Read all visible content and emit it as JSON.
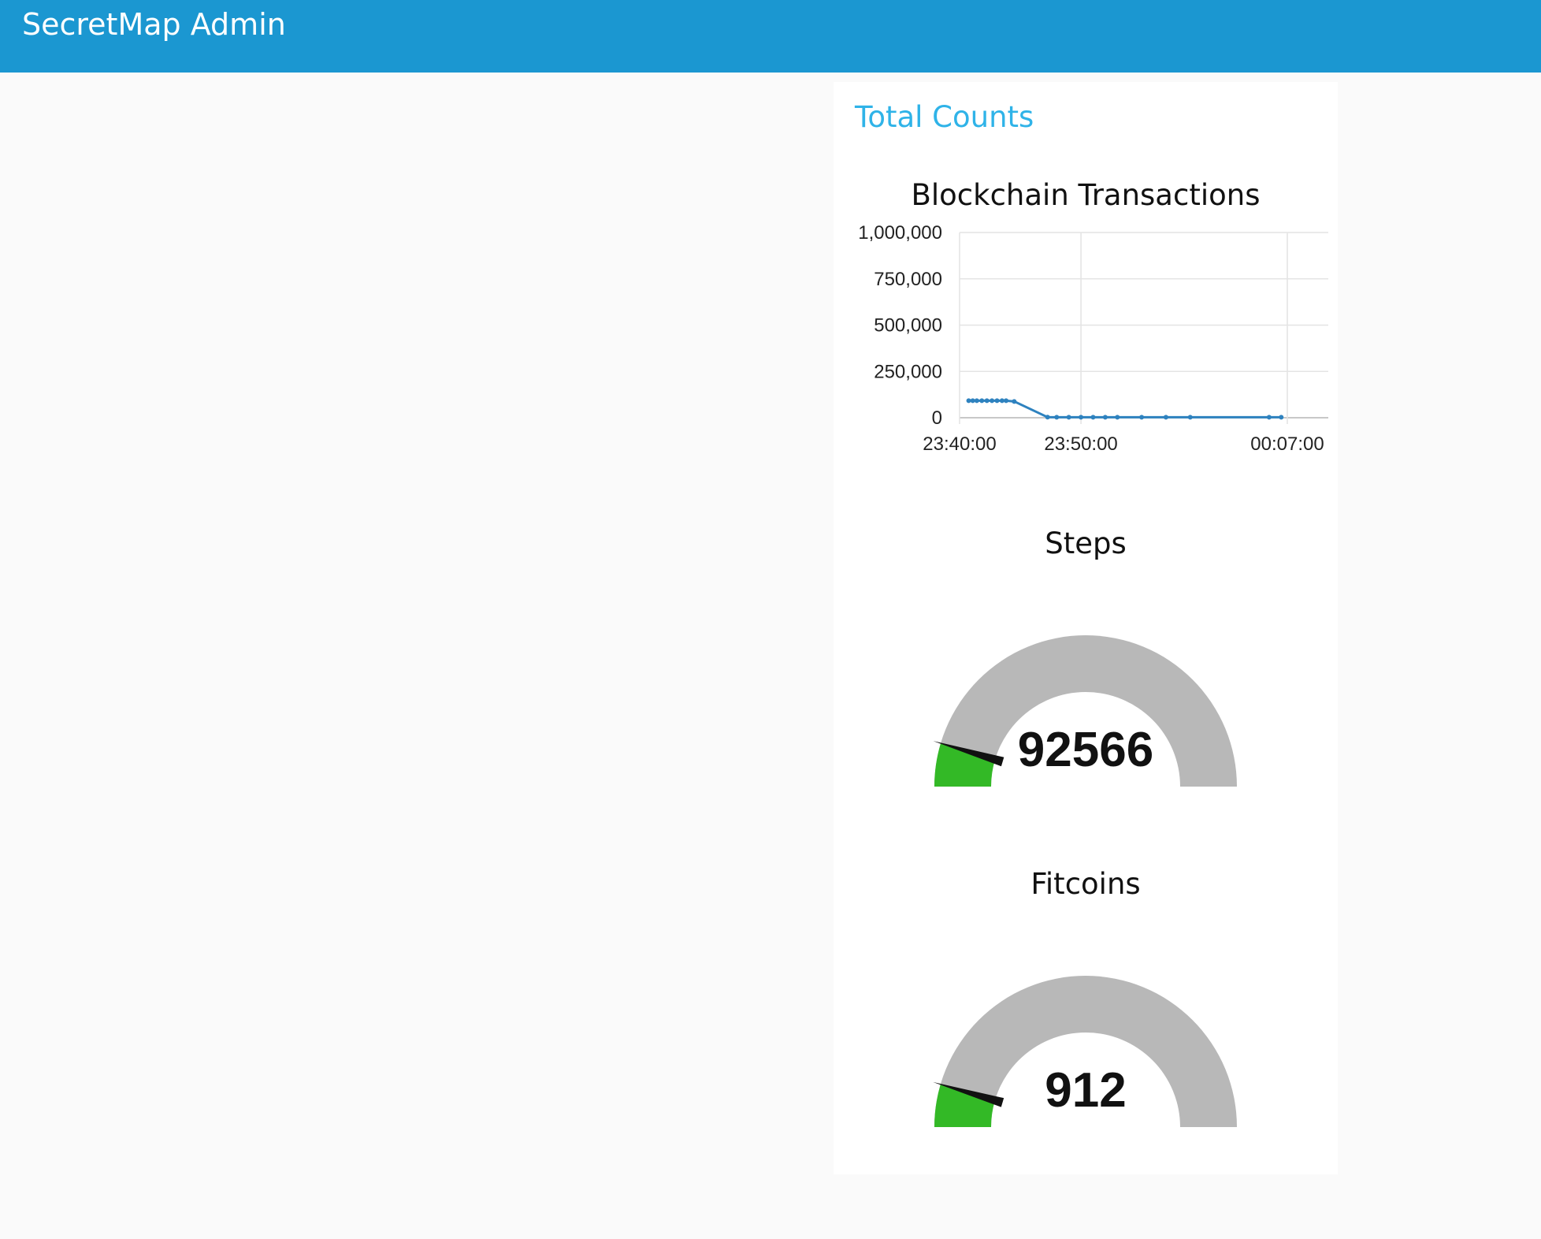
{
  "app": {
    "title": "SecretMap Admin"
  },
  "panel": {
    "title": "Total Counts"
  },
  "colors": {
    "header": "#1b97d1",
    "panel_title": "#2fb3e8",
    "line": "#2e82bf",
    "gauge_fill": "#33b926",
    "gauge_track": "#b8b8b8"
  },
  "chart_data": {
    "type": "line",
    "title": "Blockchain Transactions",
    "xlabel": "",
    "ylabel": "",
    "ylim": [
      0,
      1000000
    ],
    "yticks": [
      0,
      250000,
      500000,
      750000,
      1000000
    ],
    "ytick_labels": [
      "0",
      "250,000",
      "500,000",
      "750,000",
      "1,000,000"
    ],
    "xticks": [
      "23:40:00",
      "23:50:00",
      "00:07:00"
    ],
    "xticks_min": [
      0,
      10,
      27
    ],
    "grid": true,
    "series": [
      {
        "points": [
          {
            "x": "23:40:45",
            "y": 92000
          },
          {
            "x": "23:41:05",
            "y": 92000
          },
          {
            "x": "23:41:25",
            "y": 92000
          },
          {
            "x": "23:41:50",
            "y": 92000
          },
          {
            "x": "23:42:15",
            "y": 92000
          },
          {
            "x": "23:42:40",
            "y": 92000
          },
          {
            "x": "23:43:05",
            "y": 92000
          },
          {
            "x": "23:43:30",
            "y": 92000
          },
          {
            "x": "23:43:50",
            "y": 92000
          },
          {
            "x": "23:44:30",
            "y": 88000
          },
          {
            "x": "23:47:15",
            "y": 3000
          },
          {
            "x": "23:48:00",
            "y": 2500
          },
          {
            "x": "23:49:00",
            "y": 2500
          },
          {
            "x": "23:50:00",
            "y": 2500
          },
          {
            "x": "23:51:00",
            "y": 2500
          },
          {
            "x": "23:52:00",
            "y": 2500
          },
          {
            "x": "23:53:00",
            "y": 2500
          },
          {
            "x": "23:55:00",
            "y": 2500
          },
          {
            "x": "23:57:00",
            "y": 2500
          },
          {
            "x": "23:59:00",
            "y": 2500
          },
          {
            "x": "00:05:30",
            "y": 2500
          },
          {
            "x": "00:06:30",
            "y": 2500
          }
        ]
      }
    ]
  },
  "gauges": [
    {
      "title": "Steps",
      "value": 92566,
      "value_label": "92566",
      "min": 0,
      "max": 1000000,
      "min_label": "0",
      "max_label": "1000000"
    },
    {
      "title": "Fitcoins",
      "value": 912,
      "value_label": "912",
      "min": 0,
      "max": 10000,
      "min_label": "0",
      "max_label": "10000"
    }
  ]
}
